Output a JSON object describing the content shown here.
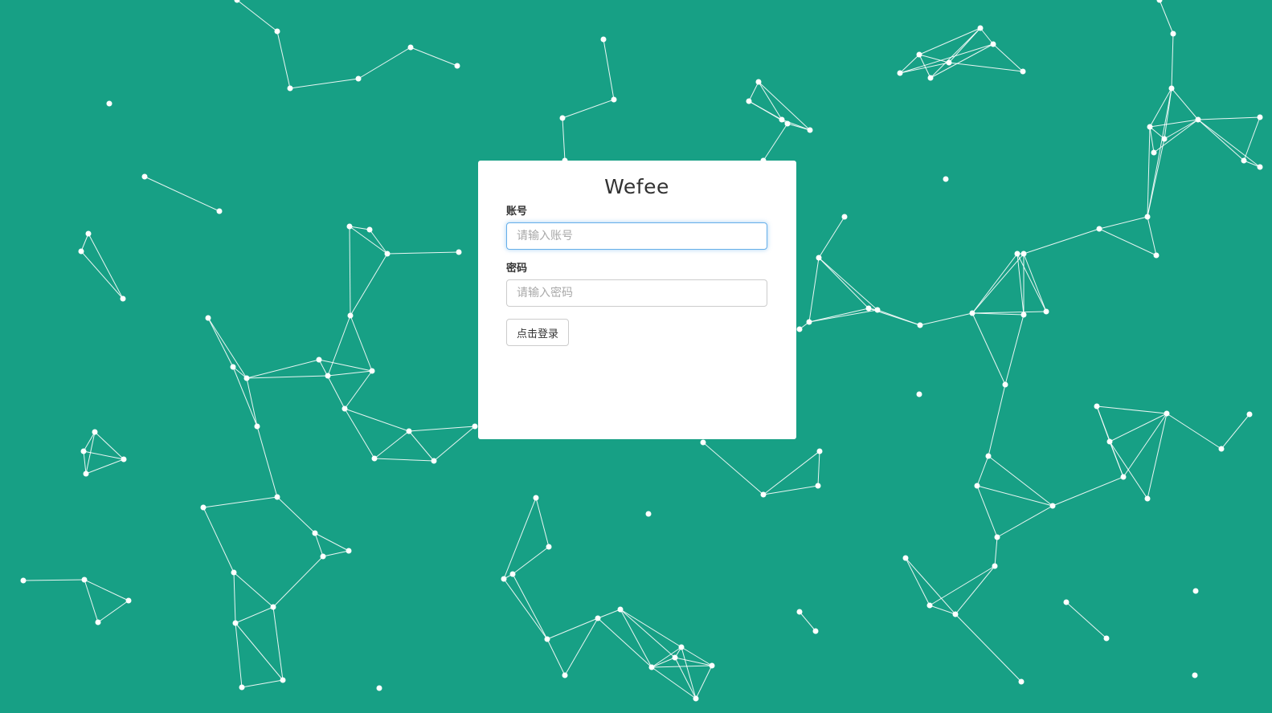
{
  "colors": {
    "background": "#17a085",
    "card": "#ffffff",
    "network": "#ffffff",
    "focus_border": "#66afe9"
  },
  "login": {
    "title": "Wefee",
    "account": {
      "label": "账号",
      "placeholder": "请输入账号",
      "value": ""
    },
    "password": {
      "label": "密码",
      "placeholder": "请输入密码",
      "value": ""
    },
    "submit_label": "点击登录"
  }
}
